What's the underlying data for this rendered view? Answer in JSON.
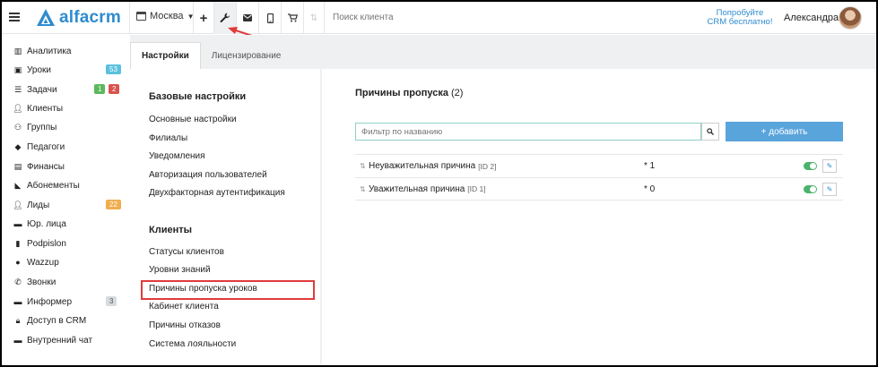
{
  "topbar": {
    "logo_text": "alfacrm",
    "branch": "Москва",
    "search_placeholder": "Поиск клиента",
    "promo_line1": "Попробуйте",
    "promo_line2": "CRM бесплатно!",
    "user_name": "Александра",
    "icons": [
      "menu-icon",
      "calendar-icon",
      "plus-icon",
      "wrench-icon",
      "mail-icon",
      "phone-icon",
      "cart-icon",
      "up-down-icon"
    ]
  },
  "sidebar": {
    "items": [
      {
        "label": "Аналитика",
        "icon": "analytics-icon"
      },
      {
        "label": "Уроки",
        "icon": "calendar-icon",
        "badge": "53"
      },
      {
        "label": "Задачи",
        "icon": "tasks-icon",
        "badge1": "1",
        "badge2": "2"
      },
      {
        "label": "Клиенты",
        "icon": "user-icon"
      },
      {
        "label": "Группы",
        "icon": "group-icon"
      },
      {
        "label": "Педагоги",
        "icon": "graduation-cap-icon"
      },
      {
        "label": "Финансы",
        "icon": "money-icon"
      },
      {
        "label": "Абонементы",
        "icon": "tag-icon"
      },
      {
        "label": "Лиды",
        "icon": "user-plus-icon",
        "badge": "22"
      },
      {
        "label": "Юр. лица",
        "icon": "briefcase-icon"
      },
      {
        "label": "Podpislon",
        "icon": "document-icon"
      },
      {
        "label": "Wazzup",
        "icon": "whatsapp-icon"
      },
      {
        "label": "Звонки",
        "icon": "phone-icon"
      },
      {
        "label": "Информер",
        "icon": "informer-icon",
        "badge": "3"
      },
      {
        "label": "Доступ в CRM",
        "icon": "lock-icon"
      },
      {
        "label": "Внутренний чат",
        "icon": "chat-icon"
      }
    ]
  },
  "tabs": [
    {
      "label": "Настройки",
      "active": true
    },
    {
      "label": "Лицензирование",
      "active": false
    }
  ],
  "settings_menu": {
    "base_title": "Базовые настройки",
    "base_items": [
      "Основные настройки",
      "Филиалы",
      "Уведомления",
      "Авторизация пользователей",
      "Двухфакторная аутентификация"
    ],
    "clients_title": "Клиенты",
    "clients_items": [
      "Статусы клиентов",
      "Уровни знаний",
      "Причины пропуска уроков",
      "Кабинет клиента",
      "Причины отказов",
      "Система лояльности"
    ]
  },
  "main": {
    "title": "Причины пропуска",
    "count": "(2)",
    "filter_placeholder": "Фильтр по названию",
    "add_label": "+ добавить",
    "rows": [
      {
        "name": "Неуважительная причина",
        "id": "[ID 2]",
        "coef": "* 1",
        "enabled": true
      },
      {
        "name": "Уважительная причина",
        "id": "[ID 1]",
        "coef": "* 0",
        "enabled": true
      }
    ]
  },
  "colors": {
    "brand": "#2e8bcf",
    "add_button": "#5aa4dc",
    "toggle_on": "#4cb36c",
    "highlight": "#e03b3b",
    "badge_teal": "#5bc0de",
    "badge_orange": "#f0ad4e"
  }
}
